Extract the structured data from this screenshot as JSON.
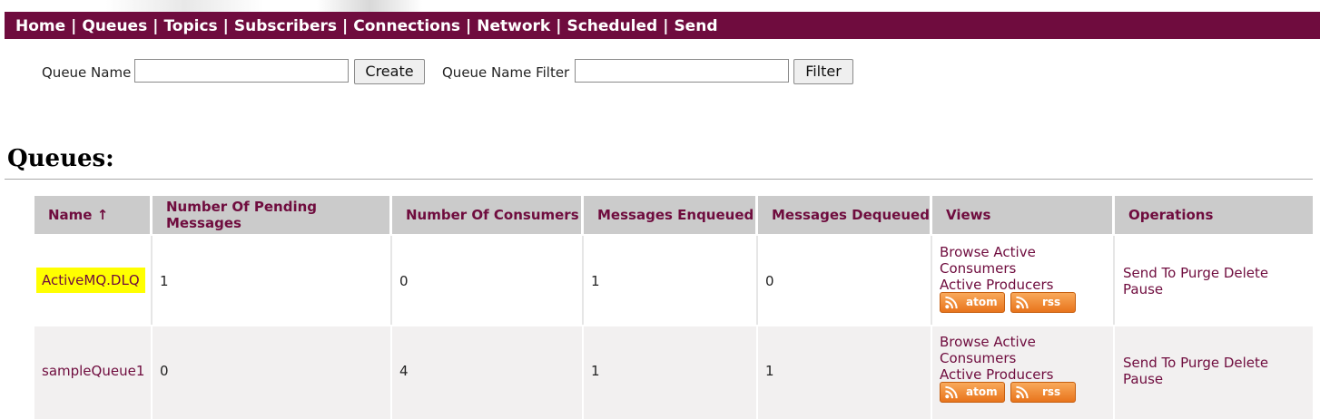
{
  "nav": {
    "items": [
      "Home",
      "Queues",
      "Topics",
      "Subscribers",
      "Connections",
      "Network",
      "Scheduled",
      "Send"
    ],
    "separator": "|"
  },
  "form": {
    "queue_name_label": "Queue Name",
    "queue_name_value": "",
    "create_label": "Create",
    "filter_label": "Queue Name Filter",
    "filter_value": "",
    "filter_button": "Filter"
  },
  "heading": "Queues:",
  "table": {
    "headers": [
      "Name ↑",
      "Number Of Pending Messages",
      "Number Of Consumers",
      "Messages Enqueued",
      "Messages Dequeued",
      "Views",
      "Operations"
    ],
    "rows": [
      {
        "name": "ActiveMQ.DLQ",
        "highlighted": true,
        "pending": "1",
        "consumers": "0",
        "enqueued": "1",
        "dequeued": "0",
        "views": {
          "browse": "Browse",
          "active_consumers": "Active Consumers",
          "active_producers": "Active Producers",
          "atom": "atom",
          "rss": "rss"
        },
        "ops": {
          "send": "Send To",
          "purge": "Purge",
          "delete": "Delete",
          "pause": "Pause"
        }
      },
      {
        "name": "sampleQueue1",
        "highlighted": false,
        "pending": "0",
        "consumers": "4",
        "enqueued": "1",
        "dequeued": "1",
        "views": {
          "browse": "Browse",
          "active_consumers": "Active Consumers",
          "active_producers": "Active Producers",
          "atom": "atom",
          "rss": "rss"
        },
        "ops": {
          "send": "Send To",
          "purge": "Purge",
          "delete": "Delete",
          "pause": "Pause"
        }
      }
    ]
  },
  "colors": {
    "brand": "#6f0c3e",
    "header_bg": "#cbcbcb",
    "highlight": "#ffff00",
    "feed_orange": "#f08c2e"
  }
}
